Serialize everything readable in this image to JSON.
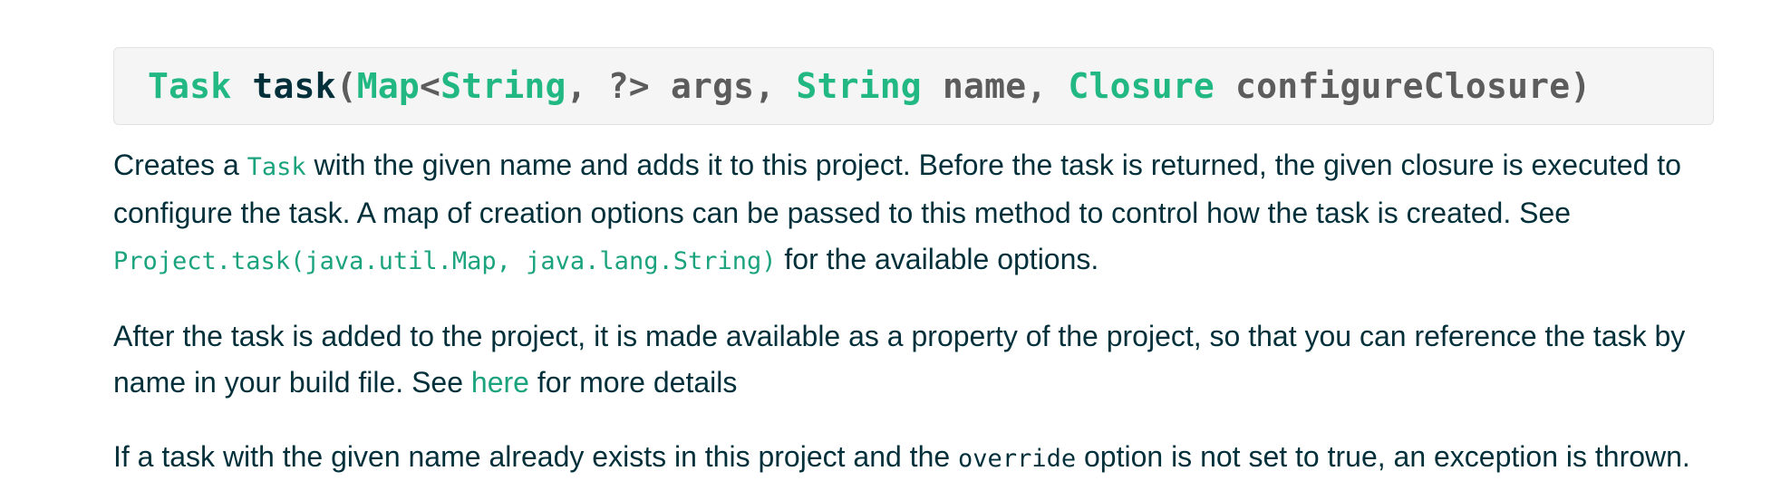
{
  "signature": {
    "return_type": "Task",
    "method_name": "task",
    "open_paren": "(",
    "param1_type_outer": "Map",
    "lt": "<",
    "param1_type_key": "String",
    "generic_rest": ", ?>",
    "param1_name": " args, ",
    "param2_type": "String",
    "param2_name": " name, ",
    "param3_type": "Closure",
    "param3_name": " configureClosure",
    "close_paren": ")"
  },
  "paragraph1": {
    "text_a": "Creates a ",
    "code_task": "Task",
    "text_b": " with the given name and adds it to this project. Before the task is returned, the given closure is executed to configure the task. A map of creation options can be passed to this method to control how the task is created. See ",
    "link_code": "Project.task(java.util.Map, java.lang.String)",
    "text_c": " for the available options."
  },
  "paragraph2": {
    "text_a": "After the task is added to the project, it is made available as a property of the project, so that you can reference the task by name in your build file. See ",
    "link_here": "here",
    "text_b": " for more details"
  },
  "paragraph3": {
    "text_a": "If a task with the given name already exists in this project and the ",
    "code_override": "override",
    "text_b": " option is not set to true, an exception is thrown."
  },
  "colors": {
    "accent_green": "#1ba37e",
    "text_dark": "#02303a",
    "code_box_bg": "#f5f5f5"
  }
}
